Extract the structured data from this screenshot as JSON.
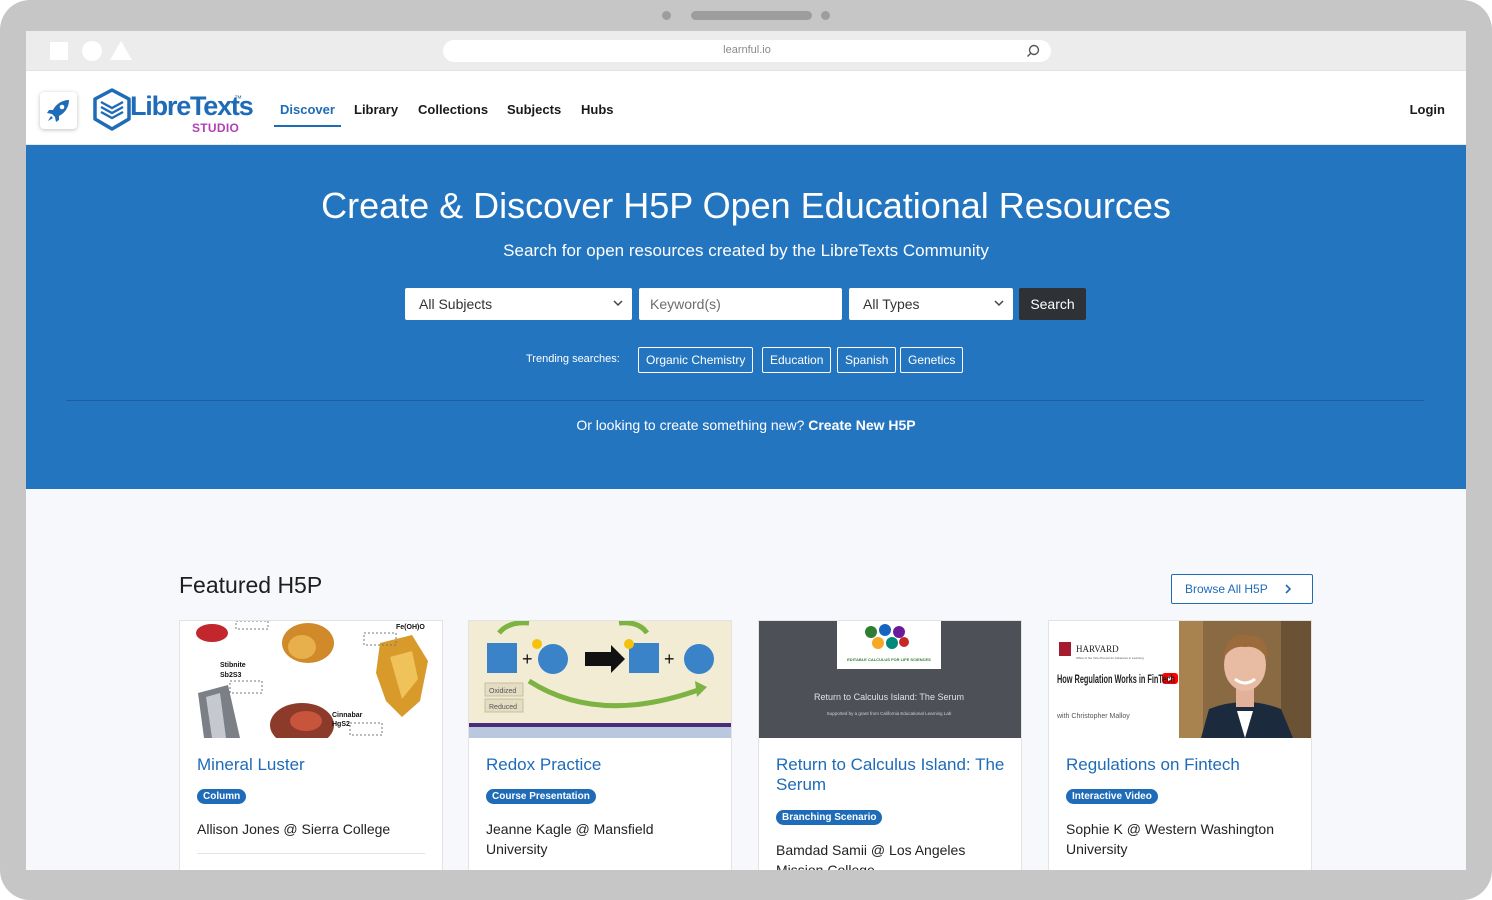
{
  "browser": {
    "url": "learnful.io"
  },
  "nav": {
    "logo_text": "LibreTexts",
    "logo_tm": "™",
    "logo_sub": "STUDIO",
    "links": [
      "Discover",
      "Library",
      "Collections",
      "Subjects",
      "Hubs"
    ],
    "active": "Discover",
    "login": "Login"
  },
  "hero": {
    "title": "Create & Discover H5P Open Educational Resources",
    "subtitle": "Search for open resources created by the LibreTexts Community",
    "subjects_select": "All Subjects",
    "keyword_placeholder": "Keyword(s)",
    "types_select": "All Types",
    "search_label": "Search",
    "trending_label": "Trending searches:",
    "trending": [
      "Organic Chemistry",
      "Education",
      "Spanish",
      "Genetics"
    ],
    "create_prompt": "Or looking to create something new?",
    "create_link": "Create New H5P"
  },
  "featured": {
    "title": "Featured H5P",
    "browse_label": "Browse All H5P",
    "cards": [
      {
        "title": "Mineral Luster",
        "badge": "Column",
        "author": "Allison Jones @ Sierra College",
        "thumb_text": [
          "Stibnite",
          "Sb2S3",
          "Cinnabar",
          "HgS2",
          "Fe(OH)O"
        ]
      },
      {
        "title": "Redox Practice",
        "badge": "Course Presentation",
        "author": "Jeanne Kagle @ Mansfield University",
        "thumb_text": [
          "Oxidized",
          "Reduced"
        ]
      },
      {
        "title": "Return to Calculus Island: The Serum",
        "badge": "Branching Scenario",
        "author": "Bamdad Samii @ Los Angeles Mission College",
        "thumb_text": [
          "Return to Calculus Island: The Serum",
          "Supported by a grant from California Educational Learning Lab",
          "EDITABLE CALCULUS FOR LIFE SCIENCES"
        ]
      },
      {
        "title": "Regulations on Fintech",
        "badge": "Interactive Video",
        "author": "Sophie K @ Western Washington University",
        "thumb_text": [
          "HARVARD",
          "Office of the Vice Provost for Advances in Learning",
          "How Regulation Works in FinTech",
          "with Christopher Malloy"
        ]
      }
    ]
  },
  "colors": {
    "primary": "#1e6bb8",
    "hero_bg": "#2475c0",
    "studio_magenta": "#b23fb5",
    "button_dark": "#2e3135"
  }
}
